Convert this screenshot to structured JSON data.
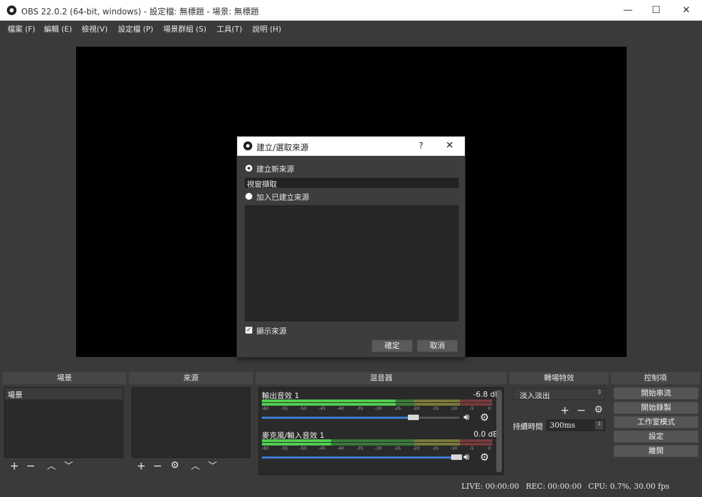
{
  "window": {
    "title": "OBS 22.0.2 (64-bit, windows) - 設定檔: 無標題 - 場景: 無標題",
    "minimize": "—",
    "maximize": "☐",
    "close": "✕"
  },
  "menu": [
    "檔案 (F)",
    "編輯 (E)",
    "檢視(V)",
    "設定檔 (P)",
    "場景群組 (S)",
    "工具(T)",
    "說明 (H)"
  ],
  "dialog": {
    "title": "建立/選取來源",
    "help": "?",
    "close": "✕",
    "create_new_label": "建立新來源",
    "name_value": "視窗擷取",
    "add_existing_label": "加入已建立來源",
    "show_source_label": "顯示來源",
    "ok_label": "確定",
    "cancel_label": "取消"
  },
  "docks": {
    "scenes": {
      "header": "場景",
      "items": [
        "場景"
      ]
    },
    "sources": {
      "header": "來源"
    },
    "mixer": {
      "header": "混音器",
      "channels": [
        {
          "name": "輸出音效 1",
          "db": "-6.8 dB",
          "level": 0.58,
          "volume": 0.78
        },
        {
          "name": "麥克風/輸入音效 1",
          "db": "0.0 dB",
          "level": 0.3,
          "volume": 1.0
        }
      ],
      "scale": [
        "-60",
        "-55",
        "-50",
        "-45",
        "-40",
        "-35",
        "-30",
        "-25",
        "-20",
        "-15",
        "-10",
        "-5",
        "0"
      ]
    },
    "transitions": {
      "header": "轉場特效",
      "selected": "淡入淡出",
      "duration_label": "持續時間",
      "duration_value": "300ms"
    },
    "controls": {
      "header": "控制項",
      "buttons": [
        "開始串流",
        "開始錄製",
        "工作室模式",
        "設定",
        "離開"
      ]
    }
  },
  "status": {
    "live": "LIVE: 00:00:00",
    "rec": "REC: 00:00:00",
    "cpu": "CPU: 0.7%, 30.00 fps"
  },
  "colors": {
    "accent": "#3c7fd6",
    "bg": "#3a3a3a",
    "panel": "#2a2a2a"
  }
}
